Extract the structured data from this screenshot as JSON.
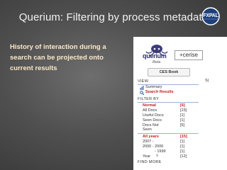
{
  "slide": {
    "title": "Querium: Filtering by process metadata",
    "body": "History of interaction during a search can be projected onto current results",
    "logo_text": "FXPAL"
  },
  "screenshot": {
    "brand_name": "querium",
    "brand_tag": "Beta",
    "partner_button": "+cerise",
    "book_button": "CES Book",
    "view_header": "VIEW",
    "cut_label": "S(",
    "view_items": [
      {
        "label": "Summary",
        "icon": "chart-icon"
      },
      {
        "label": "Search Results",
        "icon": "search-icon"
      }
    ],
    "filter_header": "FILTER BY",
    "filters": [
      {
        "label": "Normal",
        "count": "[6]",
        "highlight": true
      },
      {
        "label": "All Docs",
        "count": "[15]",
        "highlight": false
      },
      {
        "label": "Useful Docs",
        "count": "[1]",
        "highlight": false
      },
      {
        "label": "Seen Docs",
        "count": "[1]",
        "highlight": false
      },
      {
        "label": "Docs Not",
        "label2": "Seen",
        "count": "[5]",
        "highlight": false
      }
    ],
    "years": [
      {
        "label": "All years",
        "count": "[15]",
        "highlight": true
      },
      {
        "label": "2007 -",
        "count": "[1]",
        "highlight": false
      },
      {
        "label": "2000 - 2006",
        "count": "[1]",
        "highlight": false
      },
      {
        "label": "- 1999",
        "count": "[1]",
        "highlight": false
      },
      {
        "label": "Year     ?",
        "count": "[12]",
        "highlight": false
      }
    ],
    "find_more": "FIND MORE",
    "colors": {
      "accent_red": "#c01e1e",
      "rule_blue": "#9cb3d1"
    }
  }
}
